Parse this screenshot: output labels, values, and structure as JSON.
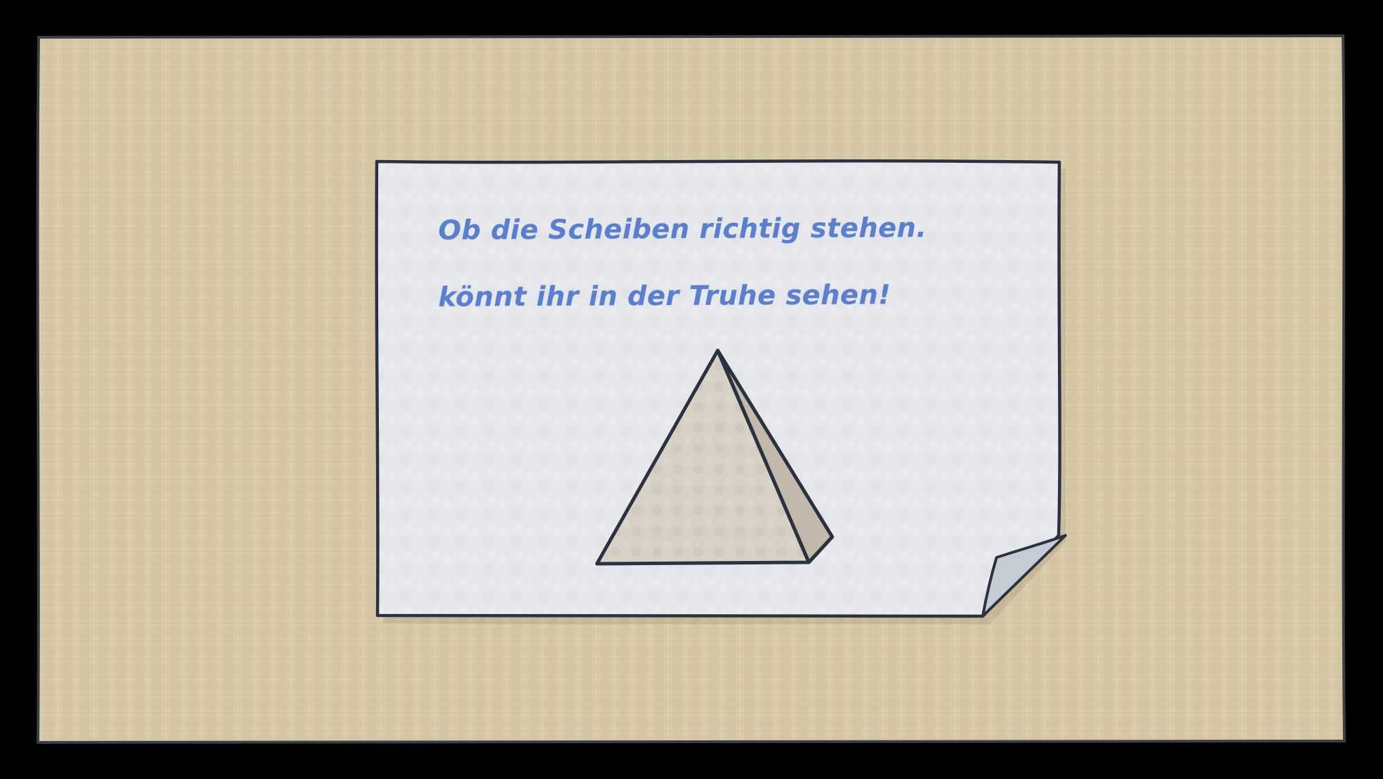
{
  "scene": {
    "colors": {
      "frame": "#000000",
      "board": "#d6c8a6",
      "paper": "#e6e8ec",
      "ink_outline": "#2a3140",
      "text_ink": "#5b7fcf",
      "pyramid_front": "#d8d1c6",
      "pyramid_side": "#c3b9ab",
      "paper_curl": "#c6ccd4"
    },
    "note": {
      "line_1": "Ob die Scheiben richtig stehen.",
      "line_2": "könnt ihr in der Truhe sehen!"
    },
    "illustration": {
      "icon": "pyramid-icon"
    }
  }
}
